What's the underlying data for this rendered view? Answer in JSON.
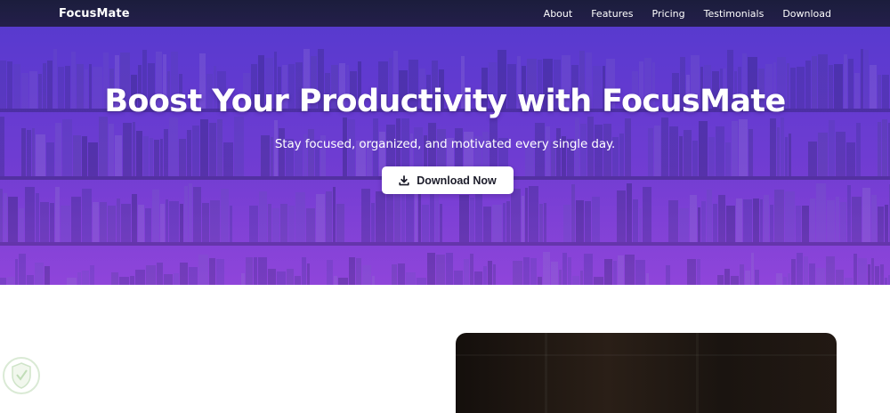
{
  "brand": "FocusMate",
  "nav": {
    "items": [
      {
        "label": "About"
      },
      {
        "label": "Features"
      },
      {
        "label": "Pricing"
      },
      {
        "label": "Testimonials"
      },
      {
        "label": "Download"
      }
    ]
  },
  "hero": {
    "title": "Boost Your Productivity with FocusMate",
    "subtitle": "Stay focused, organized, and motivated every single day.",
    "cta_label": "Download Now",
    "cta_icon": "download-icon"
  },
  "colors": {
    "navbar": "#1f1e44",
    "hero_gradient_top": "#5b39c8",
    "hero_gradient_bottom": "#8744d8",
    "button_bg": "#ffffff",
    "button_text": "#1c1c2a"
  },
  "feature_media": {
    "icon": "image-placeholder"
  },
  "watermark": {
    "icon": "shield-badge-icon"
  }
}
